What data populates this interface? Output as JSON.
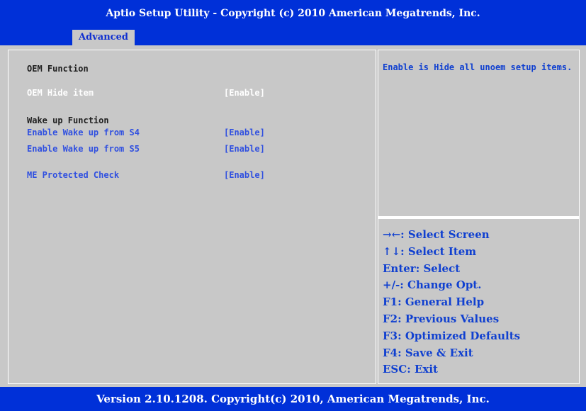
{
  "header": {
    "title": "Aptio Setup Utility - Copyright (c) 2010 American Megatrends, Inc."
  },
  "tabs": [
    {
      "label": "Advanced",
      "active": true
    }
  ],
  "menu": {
    "oem_heading": "OEM Function",
    "items": [
      {
        "label": "OEM Hide item",
        "value": "[Enable]",
        "selected": true
      },
      {
        "label": "Enable Wake up from S4",
        "value": "[Enable]",
        "selected": false
      },
      {
        "label": "Enable Wake up from S5",
        "value": "[Enable]",
        "selected": false
      },
      {
        "label": "ME Protected Check",
        "value": "[Enable]",
        "selected": false
      }
    ],
    "wake_heading": "Wake up Function"
  },
  "help": {
    "text": "Enable is Hide all unoem setup items."
  },
  "keys": [
    "→←: Select Screen",
    "↑↓: Select Item",
    "Enter: Select",
    "+/-: Change Opt.",
    "F1: General Help",
    "F2: Previous Values",
    "F3: Optimized Defaults",
    "F4: Save & Exit",
    "ESC: Exit"
  ],
  "footer": {
    "text": "Version 2.10.1208. Copyright(c) 2010, American Megatrends, Inc."
  },
  "colors": {
    "background": "#0030d8",
    "panel": "#c8c8c8",
    "option_text": "#3050e0",
    "help_text": "#1040d0",
    "selected_text": "#ffffff"
  }
}
